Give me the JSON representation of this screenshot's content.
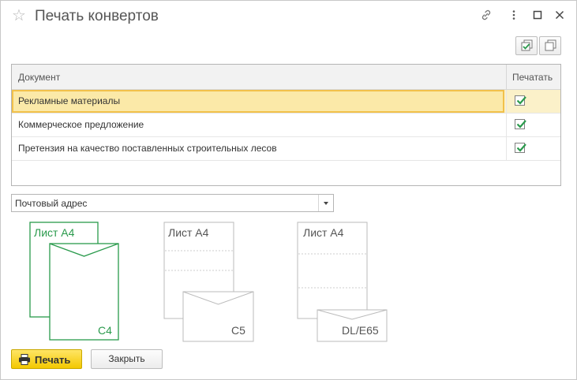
{
  "window": {
    "title": "Печать конвертов"
  },
  "table": {
    "columns": [
      "Документ",
      "Печатать"
    ],
    "rows": [
      {
        "document": "Рекламные материалы",
        "print": true
      },
      {
        "document": "Коммерческое предложение",
        "print": true
      },
      {
        "document": "Претензия на качество поставленных строительных лесов",
        "print": true
      }
    ]
  },
  "address_select": {
    "value": "Почтовый адрес"
  },
  "formats": [
    {
      "sheet": "Лист А4",
      "envelope": "C4",
      "selected": true
    },
    {
      "sheet": "Лист А4",
      "envelope": "C5",
      "selected": false
    },
    {
      "sheet": "Лист А4",
      "envelope": "DL/E65",
      "selected": false
    }
  ],
  "buttons": {
    "print": "Печать",
    "close": "Закрыть"
  },
  "colors": {
    "accent_green": "#2a9a4c",
    "selection": "#fbe9a8",
    "print_button": "#f3c800"
  }
}
